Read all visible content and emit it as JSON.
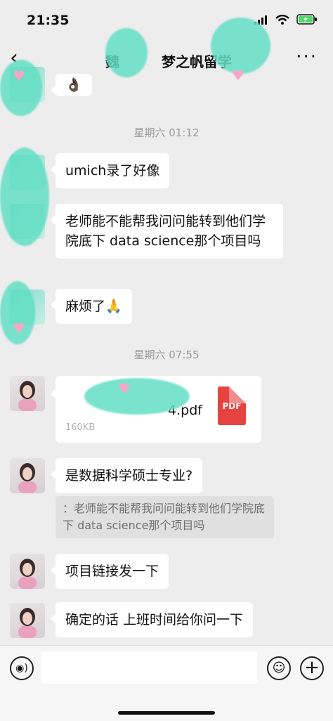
{
  "status": {
    "time": "21:35"
  },
  "nav": {
    "back": "‹",
    "title": "魏　　　梦之帆留学",
    "more": "···"
  },
  "timestamps": [
    "星期六 01:12",
    "星期六 07:55"
  ],
  "messages": {
    "emoji_top": "👌🏿",
    "m1": "umich录了好像",
    "m2": "老师能不能帮我问问能转到他们学院底下 data science那个项目吗",
    "m3": "麻烦了🙏",
    "file": {
      "name": "4.pdf",
      "size": "160KB",
      "type": "PDF"
    },
    "m4": "是数据科学硕士专业?",
    "quote": "：老师能不能帮我问问能转到他们学院底下 data science那个项目吗",
    "m5": "项目链接发一下",
    "m6": "确定的话 上班时间给你问一下"
  },
  "input": {
    "voice": "◉)",
    "emoji": "☺",
    "plus": "+"
  }
}
